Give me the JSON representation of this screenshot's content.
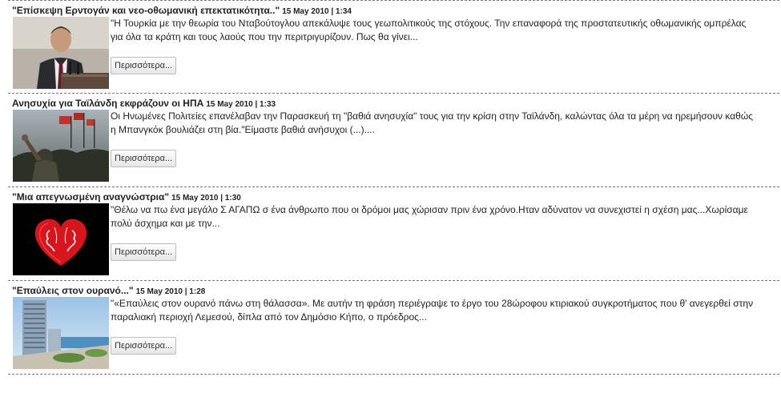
{
  "articles": [
    {
      "title": "\"Επίσκεψη Ερντογάν και νεο-οθωμανική επεκτατικότητα..\"",
      "date": "15 May 2010 | 1:34",
      "excerpt": "\"Η Τουρκία με την θεωρία του Νταβούτογλου απεκάλυψε τους γεωπολιτικούς της στόχους. Την επαναφορά της προστατευτικής οθωμανικής ομπρέλας για όλα τα κράτη και τους λαούς που την περιτριγυρίζουν. Πως θα γίνει...",
      "more_label": "Περισσότερα...",
      "image": "man-speaking-at-podium"
    },
    {
      "title": "Ανησυχία για Ταϊλάνδη εκφράζουν οι ΗΠΑ",
      "date": "15 May 2010 | 1:33",
      "excerpt": "Οι Ηνωμένες Πολιτείες επανέλαβαν την Παρασκευή τη \"βαθιά ανησυχία\" τους για την κρίση στην Ταϊλάνδη, καλώντας όλα τα μέρη να ηρεμήσουν καθώς η Μπανγκόκ βουλιάζει στη βία.\"Είμαστε βαθιά ανήσυχοι (...)....",
      "more_label": "Περισσότερα...",
      "image": "protest-crowd-flags"
    },
    {
      "title": "\"Μια απεγνωσμένη αναγνώστρια\"",
      "date": "15 May 2010 | 1:30",
      "excerpt": "\"Θέλω να πω ένα μεγάλο Σ ΑΓΑΠΩ σ ένα άνθρωπο που οι δρόμοι μας χώρισαν πριν ένα χρόνο.Ηταν αδύνατον να συνεχιστεί η σχέση μας...Χωρίσαμε πολύ άσχημα και με την...",
      "more_label": "Περισσότερα...",
      "image": "red-heart-faces"
    },
    {
      "title": "\"Επαύλεις στον ουρανό...\"",
      "date": "15 May 2010 | 1:28",
      "excerpt": "\"«Επαύλεις στον ουρανό πάνω στη θάλασσα». Με αυτήν τη φράση περιέγραψε το έργο του 28ώροφου κτιριακού συγκροτήματος που θ' ανεγερθεί στην παραλιακή περιοχή Λεμεσού, δίπλα από τον Δημόσιο Κήπο, ο πρόεδρος...",
      "more_label": "Περισσότερα...",
      "image": "seaside-tower-building"
    }
  ]
}
